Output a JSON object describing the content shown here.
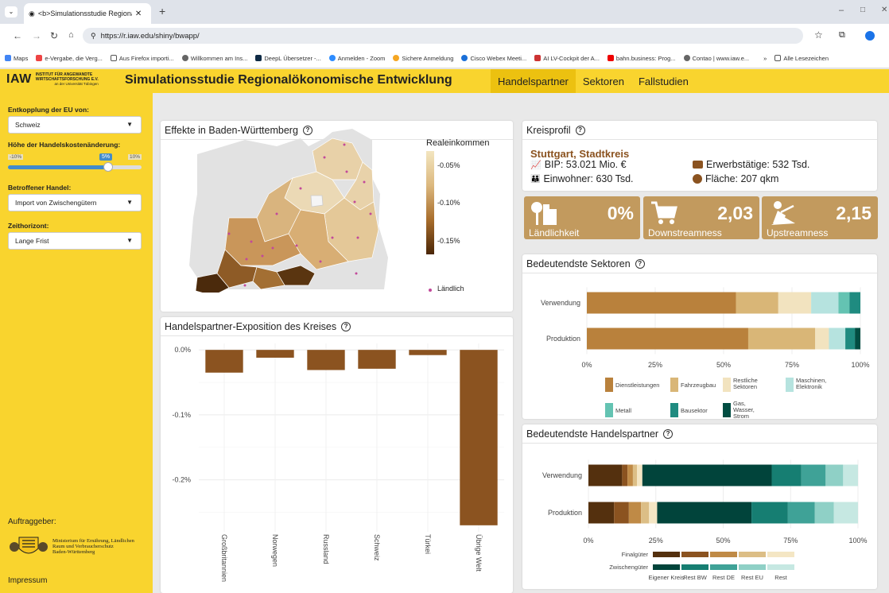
{
  "browser": {
    "tab_title": "<b>Simulationsstudie Regional",
    "url": "https://r.iaw.edu/shiny/bwapp/",
    "bookmarks": [
      "Maps",
      "e-Vergabe, die Verg...",
      "Aus Firefox importi...",
      "Willkommen am Ins...",
      "DeepL Übersetzer -...",
      "Anmelden - Zoom",
      "Sichere Anmeldung",
      "Cisco Webex Meeti...",
      "AI LV-Cockpit der A...",
      "bahn.business: Prog...",
      "Contao | www.iaw.e..."
    ],
    "bookmarks_more": "»",
    "bookmarks_folder": "Alle Lesezeichen"
  },
  "header": {
    "logo_text": "IAW",
    "logo_sub1": "Institut für Angewandte",
    "logo_sub2": "Wirtschaftsforschung e.V.",
    "logo_sub3": "an der Universität Tübingen",
    "title": "Simulationsstudie Regionalökonomische Entwicklung",
    "nav": [
      "Handelspartner",
      "Sektoren",
      "Fallstudien"
    ]
  },
  "sidebar": {
    "label_country": "Entkopplung der EU von:",
    "country": "Schweiz",
    "label_cost": "Höhe der Handelskostenänderung:",
    "slider_min": "-10%",
    "slider_val": "5%",
    "slider_max": "10%",
    "slider_level": 0.75,
    "label_trade": "Betroffener Handel:",
    "trade": "Import von Zwischengütern",
    "label_horizon": "Zeithorizont:",
    "horizon": "Lange Frist",
    "client_label": "Auftraggeber:",
    "ministry": [
      "Ministerium für Ernährung, Ländlichen",
      "Raum und Verbraucherschutz",
      "Baden-Württemberg"
    ],
    "impressum": "Impressum"
  },
  "map_panel": {
    "title": "Effekte in Baden-Württemberg",
    "legend_title": "Realeinkommen",
    "legend_ticks": [
      "-0.05%",
      "-0.10%",
      "-0.15%"
    ],
    "legend_dot": "Ländlich"
  },
  "exposure": {
    "title": "Handelspartner-Exposition des Kreises"
  },
  "profile": {
    "title": "Kreisprofil",
    "district": "Stuttgart, Stadtkreis",
    "bip": "BIP: 53.021 Mio. €",
    "employed": "Erwerbstätige: 532 Tsd.",
    "inhabitants": "Einwohner: 630 Tsd.",
    "area": "Fläche: 207 qkm"
  },
  "kpis": [
    {
      "value": "0%",
      "label": "Ländlichkeit",
      "icon": "rural-icon"
    },
    {
      "value": "2,03",
      "label": "Downstreamness",
      "icon": "cart-icon"
    },
    {
      "value": "2,15",
      "label": "Upstreamness",
      "icon": "digging-icon"
    }
  ],
  "sectors_panel": {
    "title": "Bedeutendste Sektoren"
  },
  "partners_panel": {
    "title": "Bedeutendste Handelspartner"
  },
  "chart_data": [
    {
      "type": "bar",
      "title": "Handelspartner-Exposition des Kreises",
      "categories": [
        "Großbritannien",
        "Norwegen",
        "Russland",
        "Schweiz",
        "Türkei",
        "Übrige Welt"
      ],
      "values": [
        -0.035,
        -0.012,
        -0.031,
        -0.029,
        -0.008,
        -0.27
      ],
      "yticks": [
        "0.0%",
        "-0.1%",
        "-0.2%"
      ],
      "ylim": [
        -0.28,
        0.01
      ],
      "color": "#8b5320",
      "grid": true
    },
    {
      "type": "bar",
      "title": "Bedeutendste Sektoren",
      "orientation": "horizontal",
      "stacked": true,
      "categories": [
        "Verwendung",
        "Produktion"
      ],
      "xticks": [
        "0%",
        "25%",
        "50%",
        "75%",
        "100%"
      ],
      "series": [
        {
          "name": "Dienstleistungen",
          "color": "#b9813c",
          "values": [
            54.5,
            59
          ]
        },
        {
          "name": "Fahrzeugbau",
          "color": "#d9b677",
          "values": [
            15.5,
            24.5
          ]
        },
        {
          "name": "Restliche Sektoren",
          "color": "#f2e3bf",
          "values": [
            12,
            5
          ]
        },
        {
          "name": "Maschinen, Elektronik",
          "color": "#b6e3df",
          "values": [
            10,
            6
          ]
        },
        {
          "name": "Metall",
          "color": "#64c3b2",
          "values": [
            4,
            0
          ]
        },
        {
          "name": "Bausektor",
          "color": "#1f8b80",
          "values": [
            4,
            3.5
          ]
        },
        {
          "name": "Gas, Wasser, Strom",
          "color": "#014d42",
          "values": [
            0,
            2
          ]
        }
      ]
    },
    {
      "type": "bar",
      "title": "Bedeutendste Handelspartner",
      "orientation": "horizontal",
      "stacked": true,
      "categories": [
        "Verwendung",
        "Produktion"
      ],
      "xticks": [
        "0%",
        "25%",
        "50%",
        "75%",
        "100%"
      ],
      "legend_rows": [
        "Finalgüter",
        "Zwischengüter"
      ],
      "legend_cols": [
        "Eigener Kreis",
        "Rest BW",
        "Rest DE",
        "Rest EU",
        "Rest"
      ],
      "series": [
        {
          "name": "Finalgüter – Eigener Kreis",
          "color": "#54300e",
          "values": [
            12.5,
            9.5
          ]
        },
        {
          "name": "Finalgüter – Rest BW",
          "color": "#8b5320",
          "values": [
            2,
            5.5
          ]
        },
        {
          "name": "Finalgüter – Rest DE",
          "color": "#bf8a46",
          "values": [
            2,
            4.5
          ]
        },
        {
          "name": "Finalgüter – Rest EU",
          "color": "#dcbe86",
          "values": [
            1.5,
            3
          ]
        },
        {
          "name": "Finalgüter – Rest",
          "color": "#f4e6c4",
          "values": [
            2,
            3
          ]
        },
        {
          "name": "Zwischengüter – Eigener Kreis",
          "color": "#01443b",
          "values": [
            48,
            35
          ]
        },
        {
          "name": "Zwischengüter – Rest BW",
          "color": "#167e72",
          "values": [
            11,
            13.5
          ]
        },
        {
          "name": "Zwischengüter – Rest DE",
          "color": "#3fa297",
          "values": [
            9,
            10
          ]
        },
        {
          "name": "Zwischengüter – Rest EU",
          "color": "#8fd0c6",
          "values": [
            6.5,
            7
          ]
        },
        {
          "name": "Zwischengüter – Rest",
          "color": "#c6e8e2",
          "values": [
            5.5,
            9
          ]
        }
      ]
    }
  ]
}
